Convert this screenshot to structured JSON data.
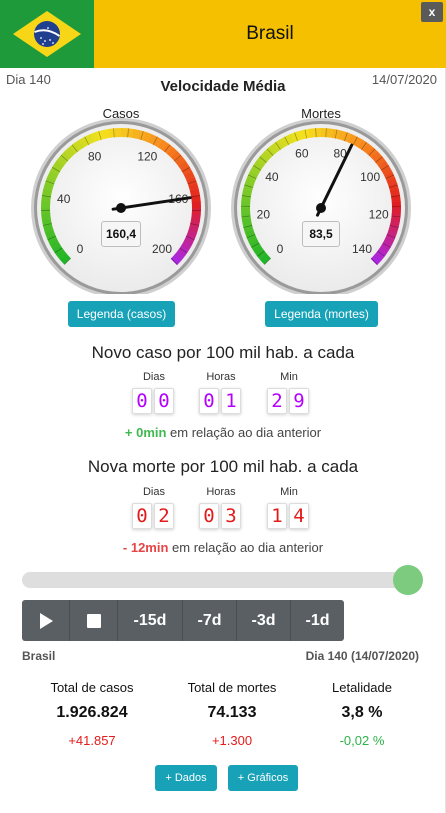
{
  "header": {
    "title": "Brasil",
    "close_label": "x",
    "flag_icon": "brazil-flag-icon"
  },
  "meta": {
    "day": "Dia 140",
    "date": "14/07/2020"
  },
  "section_title": "Velocidade Média",
  "gauges": [
    {
      "label": "Casos",
      "value": "160,4",
      "value_num": 160.4,
      "min": 0,
      "max": 200,
      "ticks": [
        "0",
        "40",
        "80",
        "120",
        "160",
        "200"
      ]
    },
    {
      "label": "Mortes",
      "value": "83,5",
      "value_num": 83.5,
      "min": 0,
      "max": 140,
      "ticks": [
        "0",
        "20",
        "40",
        "60",
        "80",
        "100",
        "120",
        "140"
      ]
    }
  ],
  "legend_buttons": [
    "Legenda (casos)",
    "Legenda (mortes)"
  ],
  "units": [
    "Dias",
    "Horas",
    "Min"
  ],
  "new_case": {
    "title": "Novo caso por 100 mil hab. a cada",
    "digits": [
      "0",
      "0",
      "0",
      "1",
      "2",
      "9"
    ],
    "delta_value": "+ 0min",
    "delta_text": " em relação ao dia anterior"
  },
  "new_death": {
    "title": "Nova morte por 100 mil hab. a cada",
    "digits": [
      "0",
      "2",
      "0",
      "3",
      "1",
      "4"
    ],
    "delta_value": "- 12min",
    "delta_text": " em relação ao dia anterior"
  },
  "slider": {
    "progress": 1.0
  },
  "controls": {
    "play_icon": "play-icon",
    "stop_icon": "stop-icon",
    "steps": [
      "-15d",
      "-7d",
      "-3d",
      "-1d"
    ]
  },
  "footer": {
    "location": "Brasil",
    "day_date": "Dia 140 (14/07/2020)"
  },
  "stats": [
    {
      "label": "Total de casos",
      "value": "1.926.824",
      "delta": "+41.857",
      "delta_color": "#e31b1b"
    },
    {
      "label": "Total de mortes",
      "value": "74.133",
      "delta": "+1.300",
      "delta_color": "#e31b1b"
    },
    {
      "label": "Letalidade",
      "value": "3,8 %",
      "delta": "-0,02 %",
      "delta_color": "#2db34a"
    }
  ],
  "actions": [
    "+ Dados",
    "+ Gráficos"
  ],
  "colors": {
    "header_yellow": "#f5c000",
    "flag_green": "#1f9a3a",
    "button_teal": "#17a2b8",
    "digit_purple": "#b400ff",
    "digit_red": "#e31b1b",
    "slider_knob": "#7ccb7f"
  }
}
